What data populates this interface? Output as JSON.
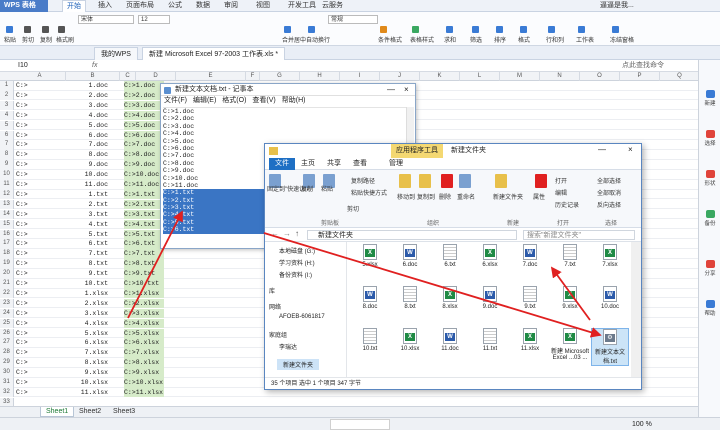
{
  "app": {
    "name": "WPS 表格",
    "ribbon_tabs": [
      "开始",
      "插入",
      "页面布局",
      "公式",
      "数据",
      "审阅",
      "视图",
      "开发工具",
      "云服务"
    ],
    "active_tab": "开始",
    "user": "逼逼是我...",
    "font_name": "宋体",
    "font_size": "12",
    "number_format": "常规",
    "ribbon_labels": [
      "粘贴",
      "剪切",
      "复制",
      "格式刷",
      "合并居中",
      "自动换行",
      "条件格式",
      "表格样式",
      "求和",
      "筛选",
      "排序",
      "格式",
      "行和列",
      "工作表",
      "冻结窗格"
    ],
    "doc_tabs": [
      "我的WPS",
      "新建 Microsoft Excel 97-2003 工作表.xls *"
    ],
    "cell_ref": "I10",
    "fx": "fx",
    "search_hint": "点此查找命令",
    "colors": {
      "accent": "#4a7cc8",
      "selected_cells": "#d6ebc9",
      "arrow": "#e02020"
    }
  },
  "grid": {
    "columns": [
      "A",
      "B",
      "C",
      "D",
      "E",
      "F",
      "G",
      "H",
      "I",
      "J",
      "K",
      "L",
      "M",
      "N",
      "O",
      "P",
      "Q"
    ],
    "rows": [
      {
        "n": "1",
        "a": "C:>",
        "c": "1.doc",
        "d": "C:>1.doc"
      },
      {
        "n": "2",
        "a": "C:>",
        "c": "2.doc",
        "d": "C:>2.doc"
      },
      {
        "n": "3",
        "a": "C:>",
        "c": "3.doc",
        "d": "C:>3.doc"
      },
      {
        "n": "4",
        "a": "C:>",
        "c": "4.doc",
        "d": "C:>4.doc"
      },
      {
        "n": "5",
        "a": "C:>",
        "c": "5.doc",
        "d": "C:>5.doc"
      },
      {
        "n": "6",
        "a": "C:>",
        "c": "6.doc",
        "d": "C:>6.doc"
      },
      {
        "n": "7",
        "a": "C:>",
        "c": "7.doc",
        "d": "C:>7.doc"
      },
      {
        "n": "8",
        "a": "C:>",
        "c": "8.doc",
        "d": "C:>8.doc"
      },
      {
        "n": "9",
        "a": "C:>",
        "c": "9.doc",
        "d": "C:>9.doc"
      },
      {
        "n": "10",
        "a": "C:>",
        "c": "10.doc",
        "d": "C:>10.doc"
      },
      {
        "n": "11",
        "a": "C:>",
        "c": "11.doc",
        "d": "C:>11.doc"
      },
      {
        "n": "12",
        "a": "C:>",
        "c": "1.txt",
        "d": "C:>1.txt"
      },
      {
        "n": "13",
        "a": "C:>",
        "c": "2.txt",
        "d": "C:>2.txt"
      },
      {
        "n": "14",
        "a": "C:>",
        "c": "3.txt",
        "d": "C:>3.txt"
      },
      {
        "n": "15",
        "a": "C:>",
        "c": "4.txt",
        "d": "C:>4.txt"
      },
      {
        "n": "16",
        "a": "C:>",
        "c": "5.txt",
        "d": "C:>5.txt"
      },
      {
        "n": "17",
        "a": "C:>",
        "c": "6.txt",
        "d": "C:>6.txt"
      },
      {
        "n": "18",
        "a": "C:>",
        "c": "7.txt",
        "d": "C:>7.txt"
      },
      {
        "n": "19",
        "a": "C:>",
        "c": "8.txt",
        "d": "C:>8.txt"
      },
      {
        "n": "20",
        "a": "C:>",
        "c": "9.txt",
        "d": "C:>9.txt"
      },
      {
        "n": "21",
        "a": "C:>",
        "c": "10.txt",
        "d": "C:>10.txt"
      },
      {
        "n": "22",
        "a": "C:>",
        "c": "1.xlsx",
        "d": "C:>1.xlsx"
      },
      {
        "n": "23",
        "a": "C:>",
        "c": "2.xlsx",
        "d": "C:>2.xlsx"
      },
      {
        "n": "24",
        "a": "C:>",
        "c": "3.xlsx",
        "d": "C:>3.xlsx"
      },
      {
        "n": "25",
        "a": "C:>",
        "c": "4.xlsx",
        "d": "C:>4.xlsx"
      },
      {
        "n": "26",
        "a": "C:>",
        "c": "5.xlsx",
        "d": "C:>5.xlsx"
      },
      {
        "n": "27",
        "a": "C:>",
        "c": "6.xlsx",
        "d": "C:>6.xlsx"
      },
      {
        "n": "28",
        "a": "C:>",
        "c": "7.xlsx",
        "d": "C:>7.xlsx"
      },
      {
        "n": "29",
        "a": "C:>",
        "c": "8.xlsx",
        "d": "C:>8.xlsx"
      },
      {
        "n": "30",
        "a": "C:>",
        "c": "9.xlsx",
        "d": "C:>9.xlsx"
      },
      {
        "n": "31",
        "a": "C:>",
        "c": "10.xlsx",
        "d": "C:>10.xlsx"
      },
      {
        "n": "32",
        "a": "C:>",
        "c": "11.xlsx",
        "d": "C:>11.xlsx"
      },
      {
        "n": "33",
        "a": "",
        "c": "",
        "d": ""
      }
    ],
    "sheets": [
      "Sheet1",
      "Sheet2",
      "Sheet3"
    ],
    "active_sheet": "Sheet1",
    "zoom": "100 %"
  },
  "notepad": {
    "title": "新建文本文档.txt - 记事本",
    "menu": [
      "文件(F)",
      "编辑(E)",
      "格式(O)",
      "查看(V)",
      "帮助(H)"
    ],
    "lines": [
      "C:>1.doc",
      "C:>2.doc",
      "C:>3.doc",
      "C:>4.doc",
      "C:>5.doc",
      "C:>6.doc",
      "C:>7.doc",
      "C:>8.doc",
      "C:>9.doc",
      "C:>10.doc",
      "C:>11.doc",
      "C:>1.txt",
      "C:>2.txt",
      "C:>3.txt",
      "C:>4.txt",
      "C:>5.txt",
      "C:>6.txt"
    ],
    "selected_line": 11
  },
  "explorer": {
    "title": "新建文件夹",
    "context_tab": "应用程序工具",
    "tabs": [
      "文件",
      "主页",
      "共享",
      "查看",
      "管理"
    ],
    "ribbon": {
      "pin": "固定到\"快速访问\"",
      "copy": "复制",
      "paste": "粘贴",
      "copy_path": "复制路径",
      "paste_shortcut": "粘贴快捷方式",
      "cut": "剪切",
      "group_clipboard": "剪贴板",
      "move_to": "移动到",
      "copy_to": "复制到",
      "delete": "删除",
      "rename": "重命名",
      "group_organize": "组织",
      "new_folder": "新建文件夹",
      "group_new": "新建",
      "properties": "属性",
      "open": "打开",
      "edit": "编辑",
      "history": "历史记录",
      "group_open": "打开",
      "select_all": "全部选择",
      "select_none": "全部取消",
      "invert": "反向选择",
      "group_select": "选择"
    },
    "address": "新建文件夹",
    "search_placeholder": "搜索\"新建文件夹\"",
    "nav": [
      "本地磁盘 (G:)",
      "学习资料 (H:)",
      "备份资料 (I:)",
      "库",
      "网络",
      "AFOEB-6061817",
      "家庭组",
      "李瑞达",
      "新建文件夹"
    ],
    "files": [
      {
        "name": "5.xlsx",
        "type": "xlsx"
      },
      {
        "name": "6.doc",
        "type": "doc"
      },
      {
        "name": "6.txt",
        "type": "txt"
      },
      {
        "name": "6.xlsx",
        "type": "xlsx"
      },
      {
        "name": "7.doc",
        "type": "doc"
      },
      {
        "name": "7.txt",
        "type": "txt"
      },
      {
        "name": "7.xlsx",
        "type": "xlsx"
      },
      {
        "name": "8.doc",
        "type": "doc"
      },
      {
        "name": "8.txt",
        "type": "txt"
      },
      {
        "name": "8.xlsx",
        "type": "xlsx"
      },
      {
        "name": "9.doc",
        "type": "doc"
      },
      {
        "name": "9.txt",
        "type": "txt"
      },
      {
        "name": "9.xlsx",
        "type": "xlsx"
      },
      {
        "name": "10.doc",
        "type": "doc"
      },
      {
        "name": "10.txt",
        "type": "txt"
      },
      {
        "name": "10.xlsx",
        "type": "xlsx"
      },
      {
        "name": "11.doc",
        "type": "doc"
      },
      {
        "name": "11.txt",
        "type": "txt"
      },
      {
        "name": "11.xlsx",
        "type": "xlsx"
      },
      {
        "name": "新建 Microsoft Excel ...03 ...",
        "type": "xlsx"
      },
      {
        "name": "新建文本文档.txt",
        "type": "bat",
        "selected": true
      }
    ],
    "status": "35 个项目    选中 1 个项目  347 字节"
  }
}
